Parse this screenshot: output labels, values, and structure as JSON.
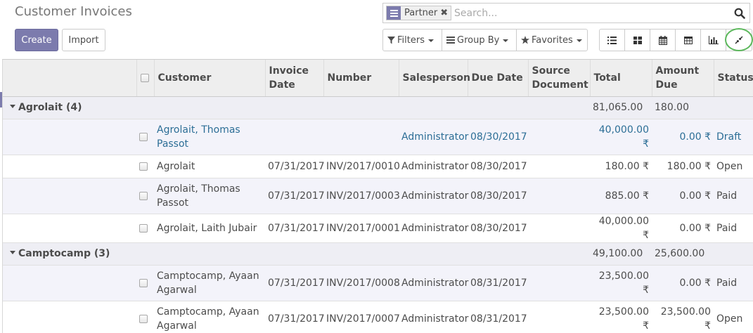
{
  "page": {
    "title": "Customer Invoices"
  },
  "search": {
    "facet_value": "Partner",
    "placeholder": "Search..."
  },
  "buttons": {
    "create": "Create",
    "import": "Import"
  },
  "filters": {
    "filters": "Filters",
    "group_by": "Group By",
    "favorites": "Favorites"
  },
  "views": [
    "list-view-icon",
    "kanban-view-icon",
    "calendar-view-icon",
    "pivot-view-icon",
    "graph-view-icon",
    "expand-icon"
  ],
  "table": {
    "columns": {
      "customer": "Customer",
      "invoice_date": "Invoice Date",
      "number": "Number",
      "salesperson": "Salesperson",
      "due_date": "Due Date",
      "source_document": "Source Document",
      "total": "Total",
      "amount_due": "Amount Due",
      "status": "Status"
    },
    "groups": [
      {
        "name": "Agrolait (4)",
        "total": "81,065.00",
        "amount_due": "180.00",
        "rows": [
          {
            "customer": "Agrolait, Thomas Passot",
            "invoice_date": "",
            "number": "",
            "salesperson": "Administrator",
            "due_date": "08/30/2017",
            "source": "",
            "total": "40,000.00 ₹",
            "amount_due": "0.00 ₹",
            "status": "Draft"
          },
          {
            "customer": "Agrolait",
            "invoice_date": "07/31/2017",
            "number": "INV/2017/0010",
            "salesperson": "Administrator",
            "due_date": "08/30/2017",
            "source": "",
            "total": "180.00 ₹",
            "amount_due": "180.00 ₹",
            "status": "Open"
          },
          {
            "customer": "Agrolait, Thomas Passot",
            "invoice_date": "07/31/2017",
            "number": "INV/2017/0003",
            "salesperson": "Administrator",
            "due_date": "08/30/2017",
            "source": "",
            "total": "885.00 ₹",
            "amount_due": "0.00 ₹",
            "status": "Paid"
          },
          {
            "customer": "Agrolait, Laith Jubair",
            "invoice_date": "07/31/2017",
            "number": "INV/2017/0001",
            "salesperson": "Administrator",
            "due_date": "08/30/2017",
            "source": "",
            "total": "40,000.00 ₹",
            "amount_due": "0.00 ₹",
            "status": "Paid"
          }
        ]
      },
      {
        "name": "Camptocamp (3)",
        "total": "49,100.00",
        "amount_due": "25,600.00",
        "rows": [
          {
            "customer": "Camptocamp, Ayaan Agarwal",
            "invoice_date": "07/31/2017",
            "number": "INV/2017/0008",
            "salesperson": "Administrator",
            "due_date": "08/31/2017",
            "source": "",
            "total": "23,500.00 ₹",
            "amount_due": "0.00 ₹",
            "status": "Paid"
          },
          {
            "customer": "Camptocamp, Ayaan Agarwal",
            "invoice_date": "07/31/2017",
            "number": "INV/2017/0007",
            "salesperson": "Administrator",
            "due_date": "08/31/2017",
            "source": "",
            "total": "23,500.00 ₹",
            "amount_due": "23,500.00 ₹",
            "status": "Open"
          }
        ]
      }
    ]
  }
}
